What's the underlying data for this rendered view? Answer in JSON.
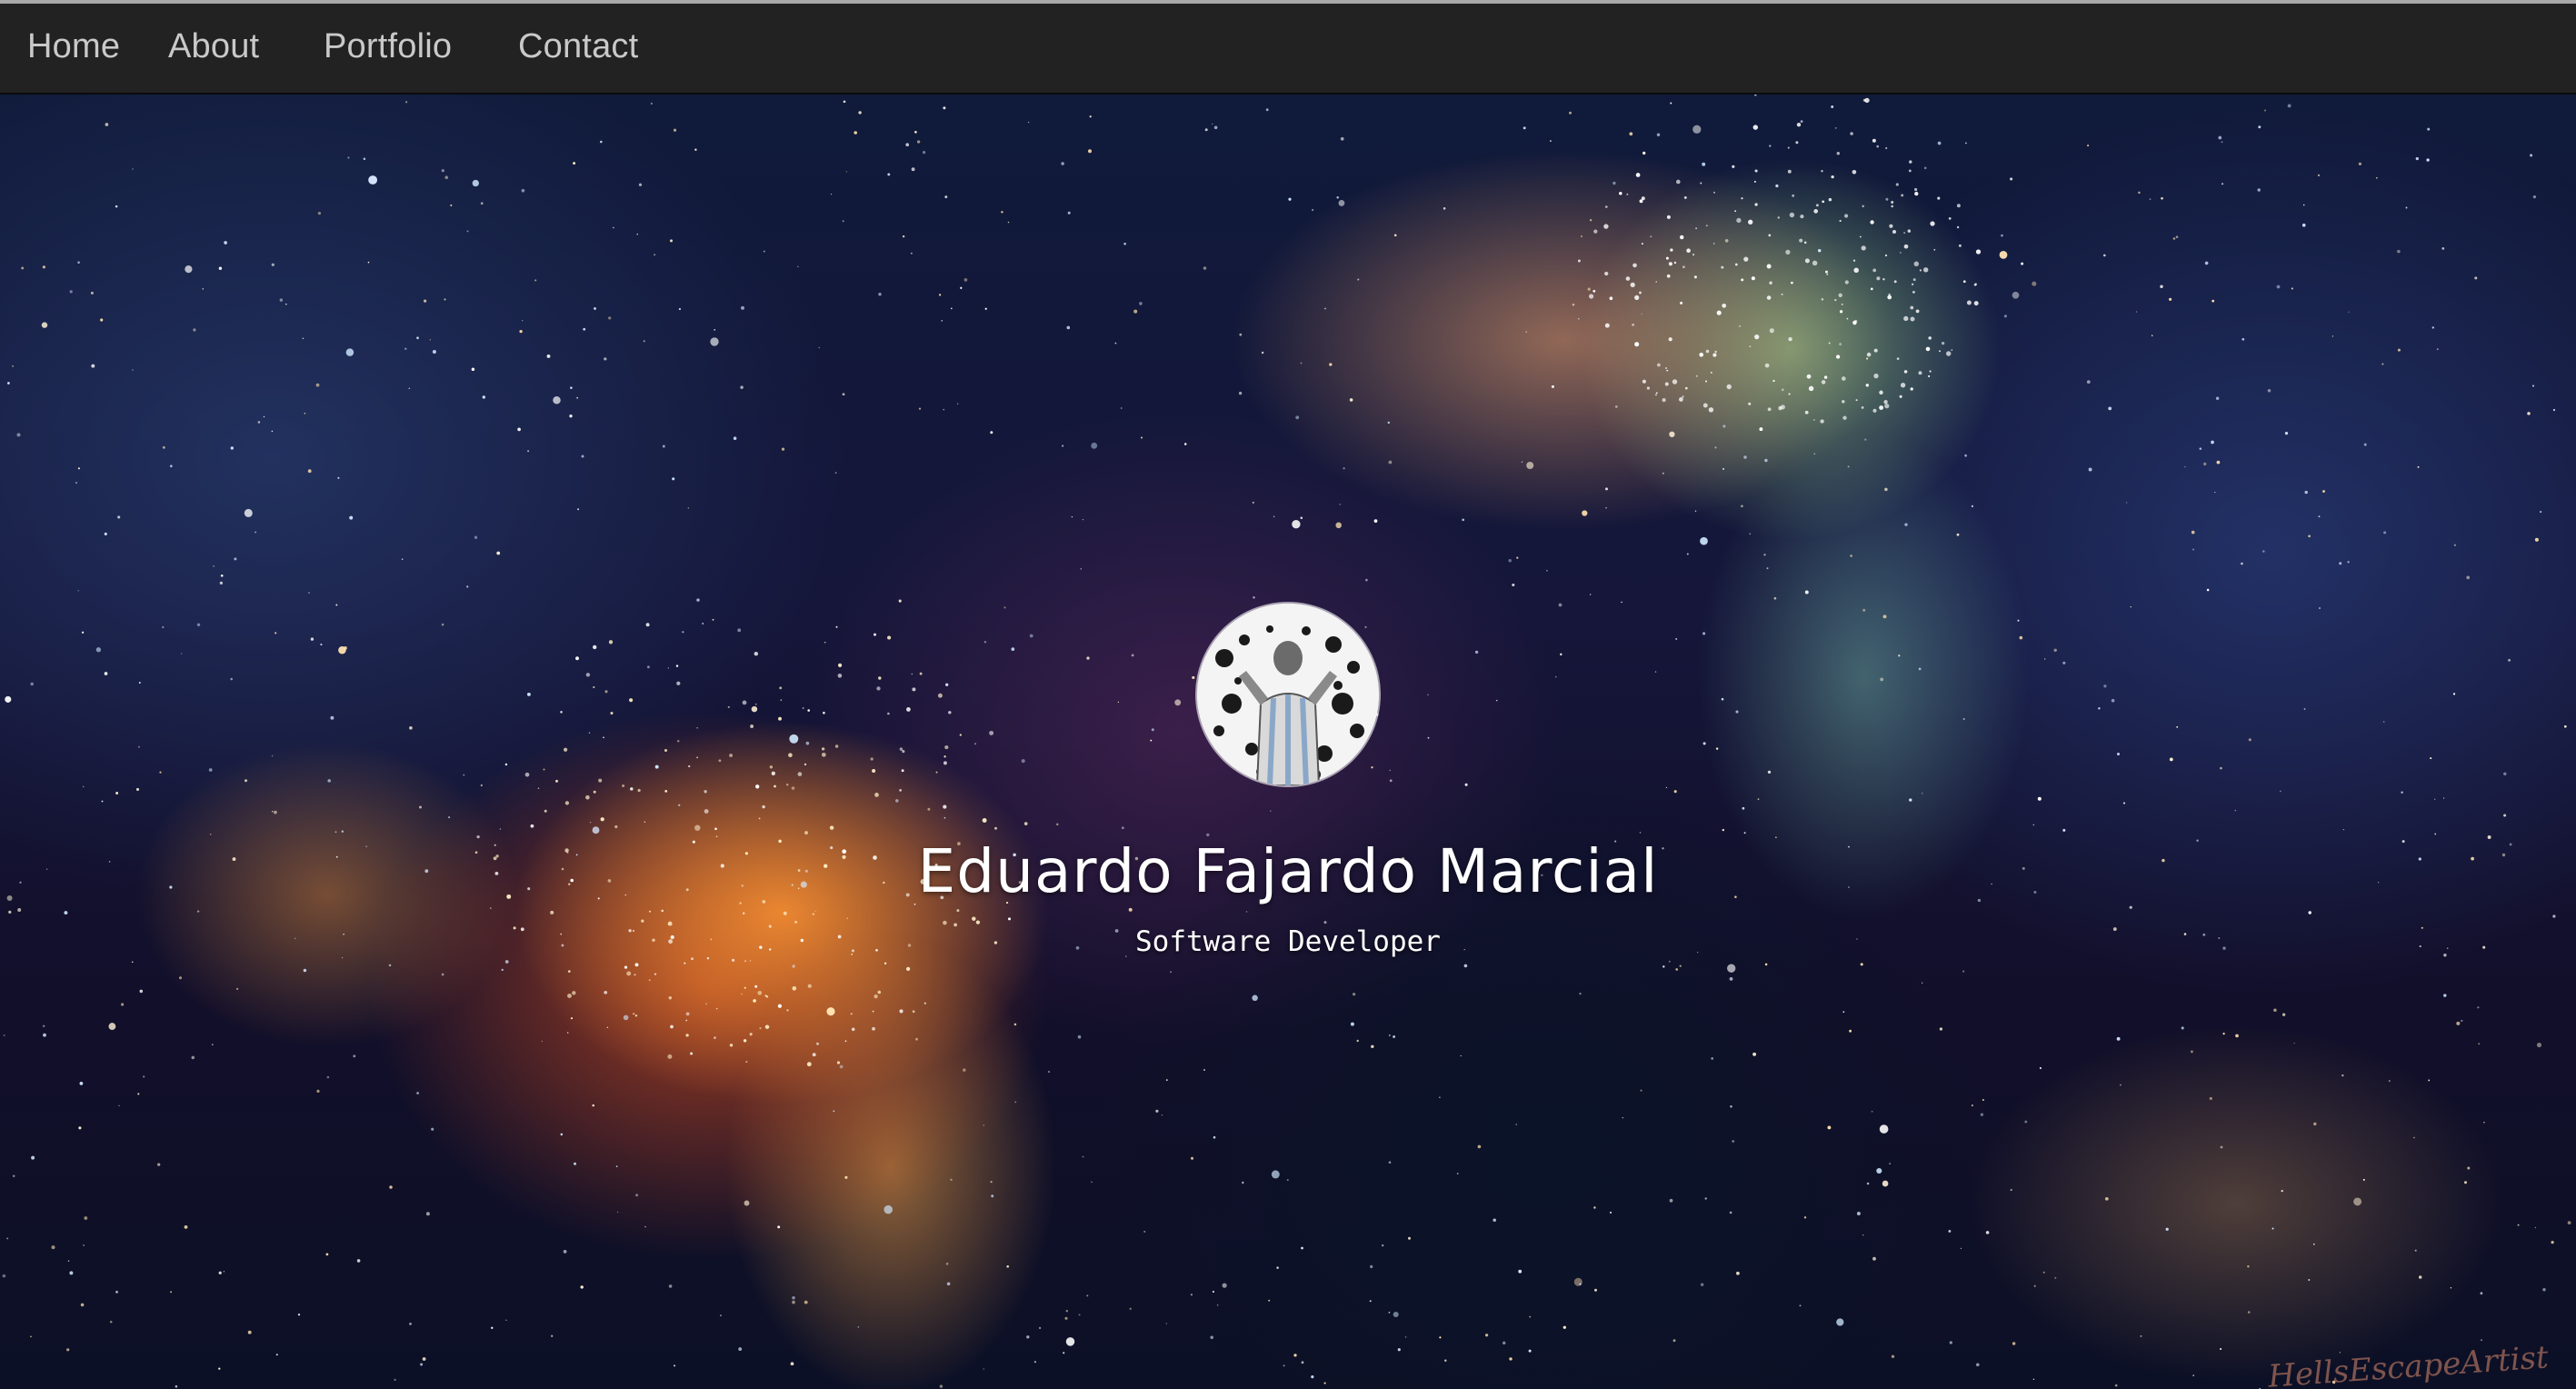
{
  "nav": {
    "items": [
      {
        "label": "Home"
      },
      {
        "label": "About"
      },
      {
        "label": "Portfolio"
      },
      {
        "label": "Contact"
      }
    ]
  },
  "hero": {
    "name": "Eduardo Fajardo Marcial",
    "role": "Software Developer",
    "avatar_icon": "profile-photo",
    "watermark": "HellsEscapeArtist"
  },
  "colors": {
    "navbar_bg": "#222222",
    "nav_text": "#c9c9c9",
    "hero_text": "#ffffff"
  }
}
